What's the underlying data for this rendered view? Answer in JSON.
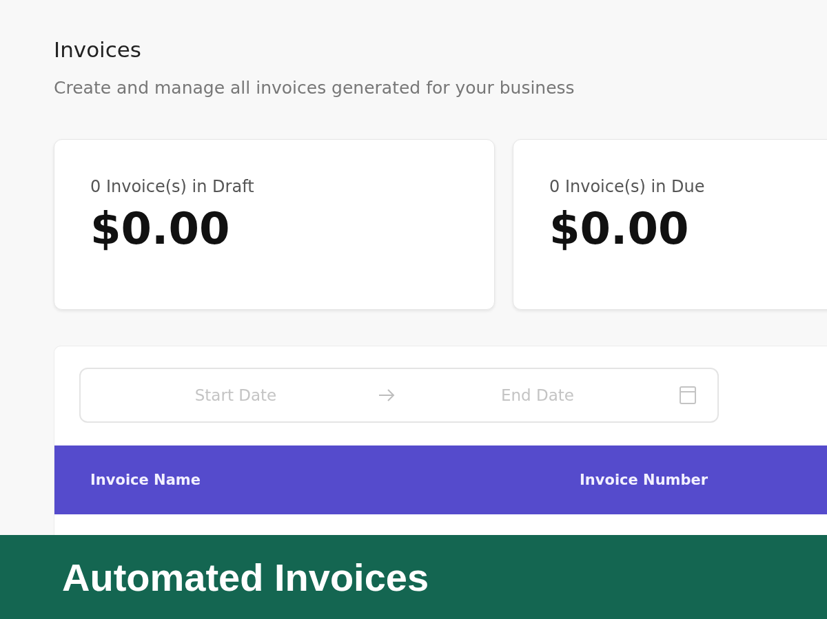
{
  "page": {
    "title": "Invoices",
    "subtitle": "Create and manage all invoices generated for your business"
  },
  "summary_cards": [
    {
      "label": "0 Invoice(s) in Draft",
      "amount": "$0.00"
    },
    {
      "label": "0 Invoice(s) in Due",
      "amount": "$0.00"
    }
  ],
  "date_range": {
    "start_placeholder": "Start Date",
    "end_placeholder": "End Date"
  },
  "table": {
    "columns": [
      "Invoice Name",
      "Invoice Number"
    ]
  },
  "banner": {
    "text": "Automated Invoices"
  }
}
